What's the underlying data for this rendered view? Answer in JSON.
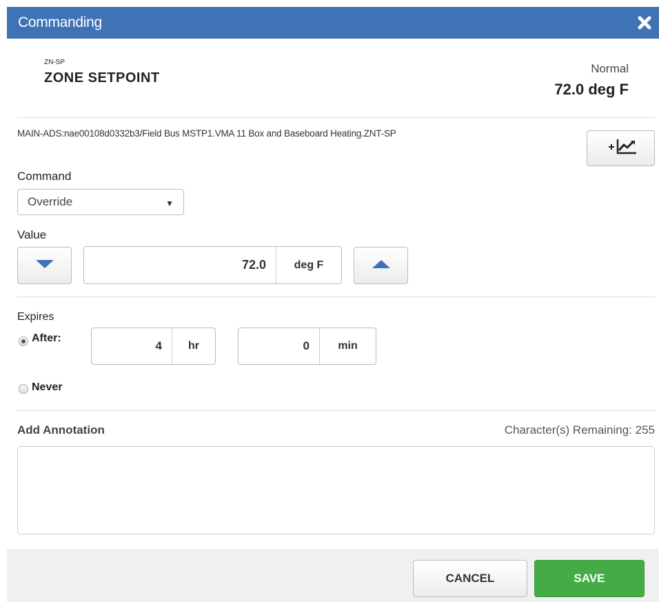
{
  "dialog": {
    "title": "Commanding",
    "title_bar_color": "#3f73b5"
  },
  "object": {
    "short_name": "ZN-SP",
    "name": "ZONE SETPOINT",
    "status": "Normal",
    "present_value": "72.0 deg F",
    "path": "MAIN-ADS:nae00108d0332b3/Field Bus MSTP1.VMA 11 Box and Baseboard Heating.ZNT-SP",
    "trend_icon": "add-trend-icon"
  },
  "command": {
    "label": "Command",
    "selected": "Override"
  },
  "value": {
    "label": "Value",
    "amount": "72.0",
    "unit": "deg F",
    "decrement_icon": "triangle-down-icon",
    "increment_icon": "triangle-up-icon",
    "arrow_color": "#3f73b5"
  },
  "expires": {
    "label": "Expires",
    "after_label": "After:",
    "after_selected": true,
    "hours": "4",
    "hours_unit": "hr",
    "minutes": "0",
    "minutes_unit": "min",
    "never_label": "Never"
  },
  "annotation": {
    "label": "Add Annotation",
    "remaining_text": "Character(s) Remaining: 255",
    "value": ""
  },
  "footer": {
    "cancel_label": "CANCEL",
    "save_label": "SAVE",
    "save_color": "#45ac45"
  }
}
